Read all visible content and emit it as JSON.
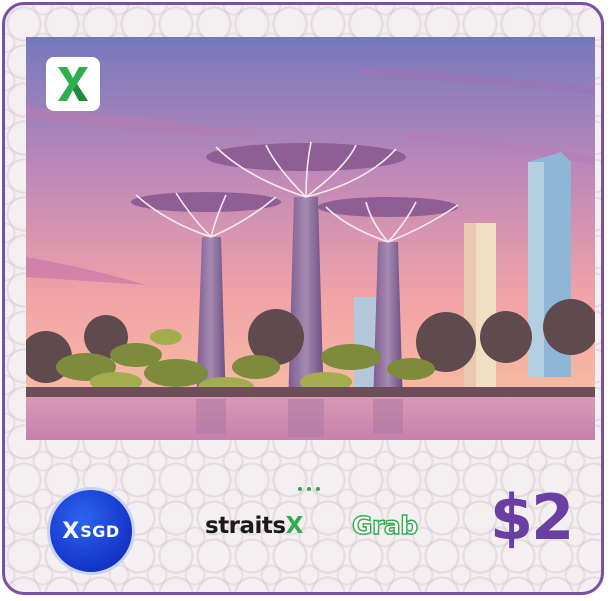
{
  "card": {
    "brand_icon": "straitsx-x-logo-icon",
    "scene_icon": "gardens-by-the-bay-supertree-scene",
    "carousel_dots": 3,
    "token": {
      "prefix": "X",
      "label": "SGD"
    },
    "partner_straitsx": {
      "main": "straits",
      "suffix": "X"
    },
    "partner_grab": "Grab",
    "amount": "$2"
  },
  "colors": {
    "border": "#7b4fa3",
    "amount": "#6a3fa3",
    "green": "#2fae4f",
    "token_blue": "#1334c7"
  }
}
